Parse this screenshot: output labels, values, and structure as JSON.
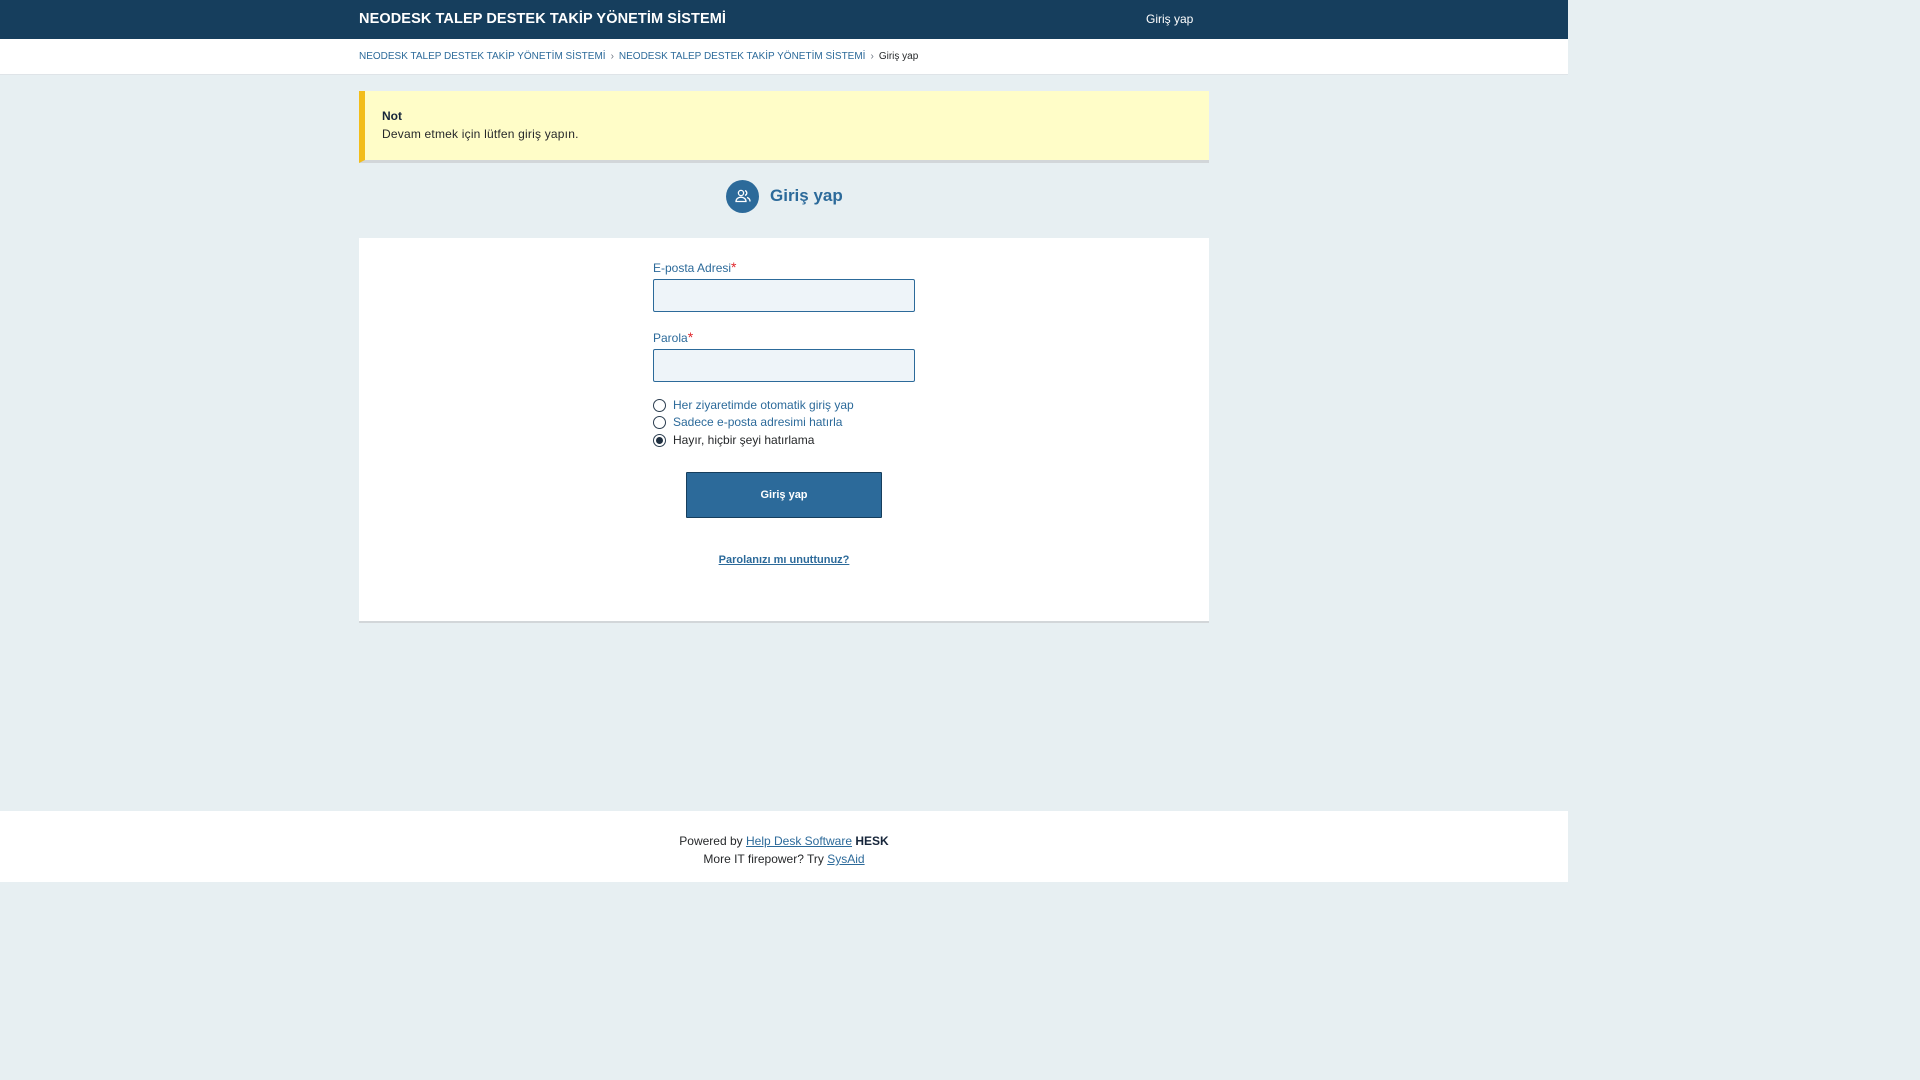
{
  "header": {
    "brand": "NEODESK TALEP DESTEK TAKİP YÖNETİM SİSTEMİ",
    "login_link": "Giriş yap"
  },
  "breadcrumb": {
    "items": [
      "NEODESK TALEP DESTEK TAKİP YÖNETİM SİSTEMİ",
      "NEODESK TALEP DESTEK TAKİP YÖNETİM SİSTEMİ"
    ],
    "current": "Giriş yap",
    "separator": "›"
  },
  "notice": {
    "title": "Not",
    "text": "Devam etmek için lütfen giriş yapın."
  },
  "heading": {
    "icon": "users-icon",
    "title": "Giriş yap"
  },
  "form": {
    "email_label": "E-posta Adresi",
    "email_value": "",
    "password_label": "Parola",
    "password_value": "",
    "required_mark": "*",
    "remember_options": [
      {
        "label": "Her ziyaretimde otomatik giriş yap",
        "checked": false
      },
      {
        "label": "Sadece e-posta adresimi hatırla",
        "checked": false
      },
      {
        "label": "Hayır, hiçbir şeyi hatırlama",
        "checked": true
      }
    ],
    "submit_label": "Giriş yap",
    "forgot_link": "Parolanızı mı unuttunuz?"
  },
  "footer": {
    "powered_prefix": "Powered by",
    "powered_link": "Help Desk Software",
    "powered_brand": "HESK",
    "more_prefix": "More IT firepower? Try",
    "more_link": "SysAid"
  },
  "colors": {
    "header_bg": "#163e5d",
    "accent": "#2c6a9a",
    "notice_bg": "#fffdc8",
    "notice_border": "#f2bd1a",
    "page_bg": "#e7eff2",
    "required": "#e0262b"
  }
}
